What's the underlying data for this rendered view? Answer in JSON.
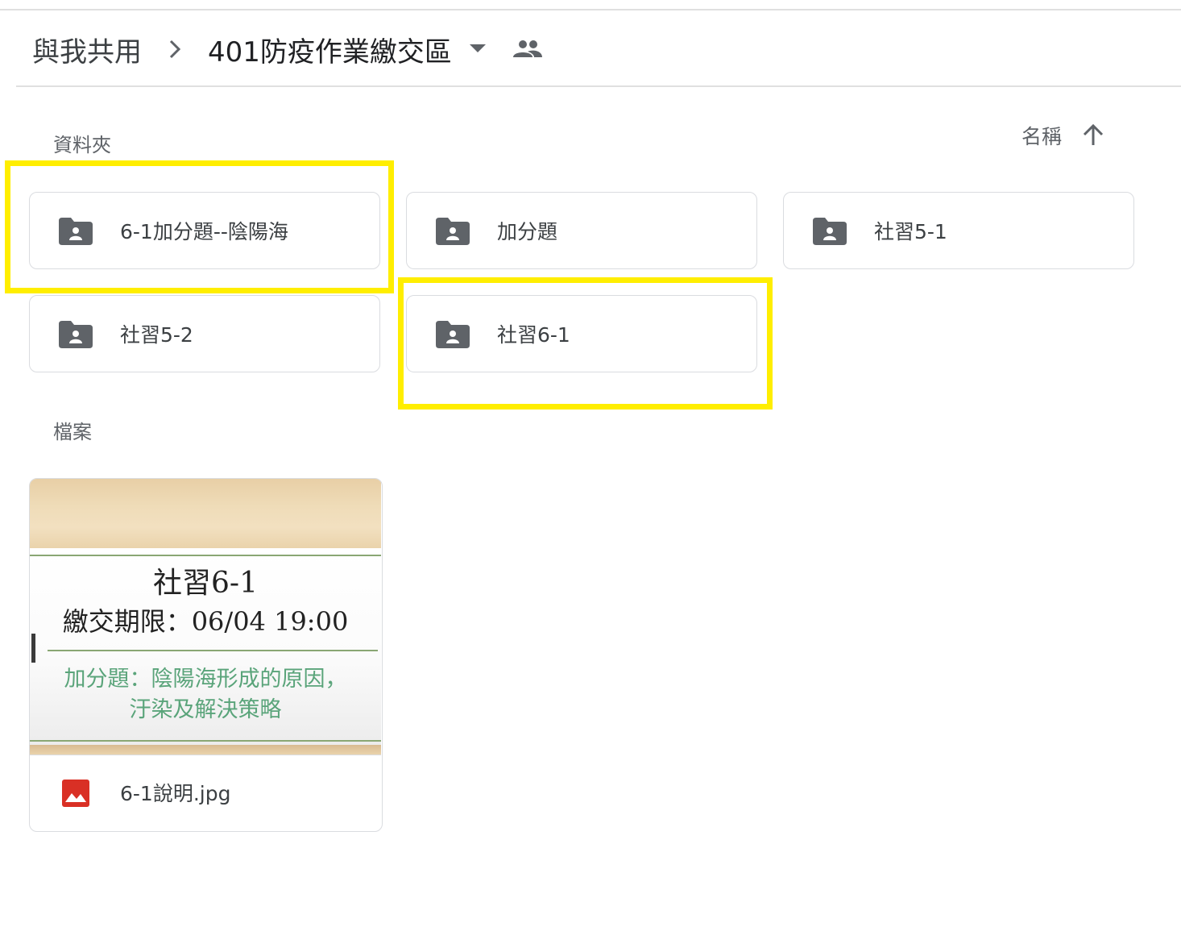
{
  "breadcrumb": {
    "root": "與我共用",
    "separator_icon": "chevron-right-icon",
    "current": "401防疫作業繳交區",
    "dropdown_icon": "caret-down-icon",
    "shared_icon": "people-icon"
  },
  "sections": {
    "folders_label": "資料夾",
    "files_label": "檔案"
  },
  "sort": {
    "label": "名稱",
    "direction_icon": "arrow-up-icon"
  },
  "folders": [
    {
      "name": "6-1加分題--陰陽海",
      "icon": "shared-folder-icon",
      "highlighted": true
    },
    {
      "name": "加分題",
      "icon": "shared-folder-icon",
      "highlighted": false
    },
    {
      "name": "社習5-1",
      "icon": "shared-folder-icon",
      "highlighted": false
    },
    {
      "name": "社習5-2",
      "icon": "shared-folder-icon",
      "highlighted": false
    },
    {
      "name": "社習6-1",
      "icon": "shared-folder-icon",
      "highlighted": true
    }
  ],
  "files": [
    {
      "name": "6-1說明.jpg",
      "icon": "image-file-icon",
      "thumbnail": {
        "line1": "社習6-1",
        "line2": "繳交期限：06/04 19:00",
        "line3": "加分題：陰陽海形成的原因，",
        "line4": "汙染及解決策略"
      }
    }
  ],
  "colors": {
    "highlight": "#ffee00",
    "folder_icon": "#5f6368",
    "image_icon": "#d93025",
    "thumbnail_subtitle": "#5aa47a"
  }
}
